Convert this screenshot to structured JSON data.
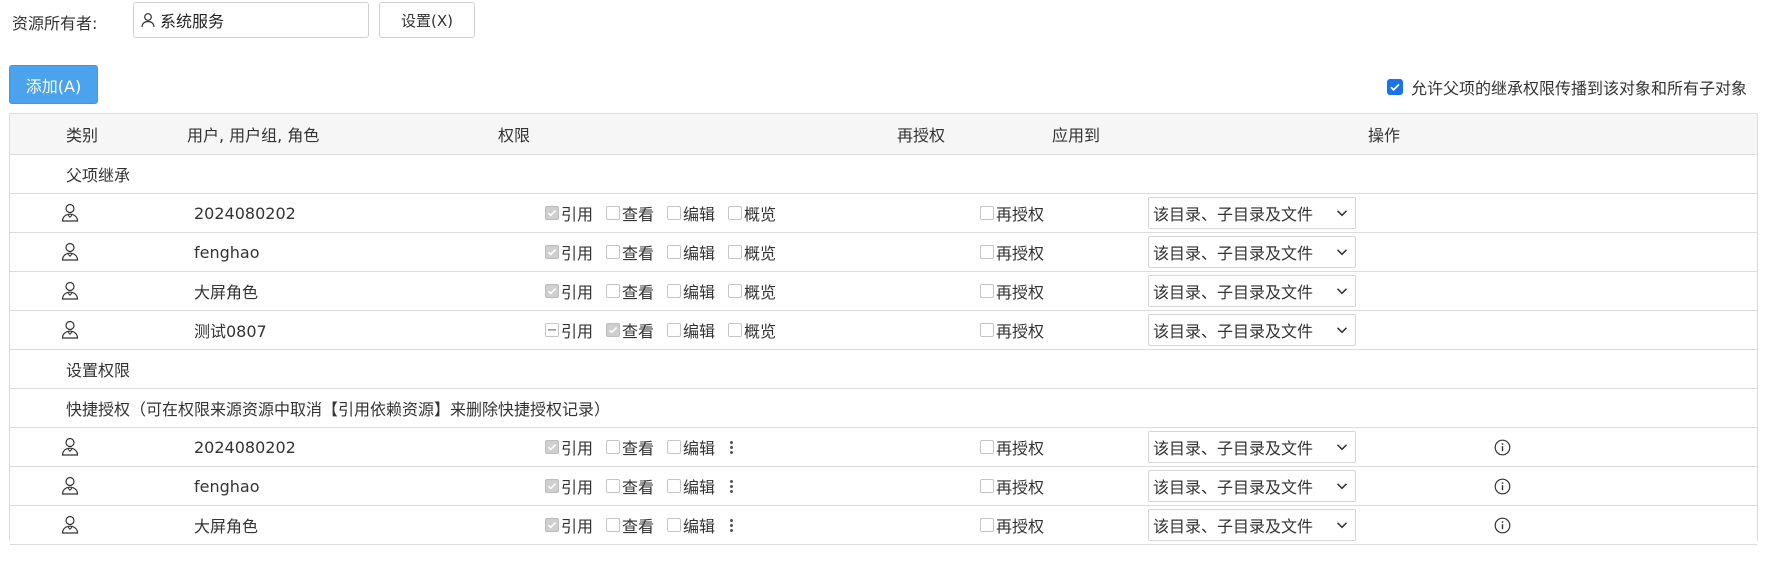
{
  "owner": {
    "label": "资源所有者:",
    "value": "系统服务",
    "set_button": "设置(X)"
  },
  "toolbar": {
    "add_button": "添加(A)"
  },
  "propagate": {
    "label": "允许父项的继承权限传播到该对象和所有子对象",
    "checked": true
  },
  "columns": {
    "category": "类别",
    "users": "用户, 用户组, 角色",
    "permissions": "权限",
    "regrant": "再授权",
    "apply_to": "应用到",
    "operations": "操作"
  },
  "sections": {
    "inherited": "父项继承",
    "set_permissions": "设置权限",
    "quick_grant": "快捷授权（可在权限来源资源中取消【引用依赖资源】来删除快捷授权记录）"
  },
  "perm_labels": {
    "ref": "引用",
    "view": "查看",
    "edit": "编辑",
    "overview": "概览",
    "regrant": "再授权"
  },
  "apply_option": "该目录、子目录及文件",
  "inherited_rows": [
    {
      "name": "2024080202",
      "ref": "checked",
      "view": false,
      "edit": false,
      "overview": false,
      "regrant": false
    },
    {
      "name": "fenghao",
      "ref": "checked",
      "view": false,
      "edit": false,
      "overview": false,
      "regrant": false
    },
    {
      "name": "大屏角色",
      "ref": "checked",
      "view": false,
      "edit": false,
      "overview": false,
      "regrant": false
    },
    {
      "name": "测试0807",
      "ref": "indeterminate",
      "view": true,
      "edit": false,
      "overview": false,
      "regrant": false
    }
  ],
  "quick_rows": [
    {
      "name": "2024080202",
      "ref": "checked",
      "view": false,
      "edit": false,
      "regrant": false
    },
    {
      "name": "fenghao",
      "ref": "checked",
      "view": false,
      "edit": false,
      "regrant": false
    },
    {
      "name": "大屏角色",
      "ref": "checked",
      "view": false,
      "edit": false,
      "regrant": false
    }
  ],
  "colors": {
    "primary": "#4aa3ec",
    "checkbox_blue": "#1a73e8",
    "border": "#dcdcdc",
    "header_bg": "#f6f6f6"
  },
  "icons": {
    "owner": "user-icon",
    "row": "user-icon",
    "apply_select": "chevron-down-icon",
    "operation": "info-icon",
    "more": "more-vertical-icon"
  }
}
